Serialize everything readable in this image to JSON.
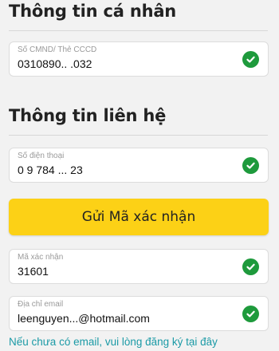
{
  "personal_section": {
    "title": "Thông tin cá nhân",
    "id_field": {
      "label": "Số CMND/ Thẻ CCCD",
      "value": "0310890.. .032",
      "status_icon": "check-circle-icon"
    }
  },
  "contact_section": {
    "title": "Thông tin liên hệ",
    "phone_field": {
      "label": "Số điện thoại",
      "value": "0 9 784 ... 23",
      "status_icon": "check-circle-icon"
    },
    "send_code_button": "Gửi Mã xác nhận",
    "code_field": {
      "label": "Mã xác nhận",
      "value": "31601",
      "status_icon": "check-circle-icon"
    },
    "email_field": {
      "label": "Địa chỉ email",
      "value": "leenguyen...@hotmail.com",
      "status_icon": "check-circle-icon"
    },
    "no_email_link": "Nếu chưa có email, vui lòng đăng ký tại đây"
  },
  "colors": {
    "accent_button": "#fcd116",
    "success": "#1e9a3c",
    "link": "#1b9aa6"
  }
}
